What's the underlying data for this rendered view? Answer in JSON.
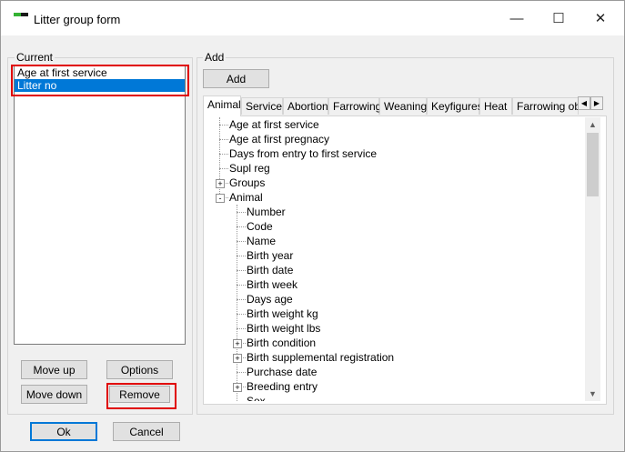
{
  "window": {
    "title": "Litter group form",
    "minimize_glyph": "—",
    "maximize_glyph": "☐",
    "close_glyph": "✕"
  },
  "current": {
    "label": "Current",
    "items": [
      {
        "label": "Age at first service",
        "selected": false
      },
      {
        "label": "Litter no",
        "selected": true
      }
    ],
    "move_up": "Move up",
    "move_down": "Move down",
    "options": "Options",
    "remove": "Remove"
  },
  "add": {
    "label": "Add",
    "add_button": "Add",
    "tabs": [
      "Animal",
      "Service",
      "Abortion",
      "Farrowing",
      "Weaning",
      "Keyfigures",
      "Heat",
      "Farrowing ob"
    ],
    "active_tab": "Animal",
    "tree": [
      {
        "label": "Age at first service",
        "level": 0,
        "expander": ""
      },
      {
        "label": "Age at first pregnacy",
        "level": 0,
        "expander": ""
      },
      {
        "label": "Days from entry to first service",
        "level": 0,
        "expander": ""
      },
      {
        "label": "Supl reg",
        "level": 0,
        "expander": ""
      },
      {
        "label": "Groups",
        "level": 0,
        "expander": "+"
      },
      {
        "label": "Animal",
        "level": 0,
        "expander": "-"
      },
      {
        "label": "Number",
        "level": 1,
        "expander": ""
      },
      {
        "label": "Code",
        "level": 1,
        "expander": ""
      },
      {
        "label": "Name",
        "level": 1,
        "expander": ""
      },
      {
        "label": "Birth year",
        "level": 1,
        "expander": ""
      },
      {
        "label": "Birth date",
        "level": 1,
        "expander": ""
      },
      {
        "label": "Birth week",
        "level": 1,
        "expander": ""
      },
      {
        "label": "Days age",
        "level": 1,
        "expander": ""
      },
      {
        "label": "Birth weight kg",
        "level": 1,
        "expander": ""
      },
      {
        "label": "Birth weight lbs",
        "level": 1,
        "expander": ""
      },
      {
        "label": "Birth condition",
        "level": 1,
        "expander": "+"
      },
      {
        "label": "Birth supplemental registration",
        "level": 1,
        "expander": "+"
      },
      {
        "label": "Purchase date",
        "level": 1,
        "expander": ""
      },
      {
        "label": "Breeding entry",
        "level": 1,
        "expander": "+"
      },
      {
        "label": "Sex",
        "level": 1,
        "expander": ""
      }
    ]
  },
  "footer": {
    "ok": "Ok",
    "cancel": "Cancel"
  },
  "colors": {
    "selection": "#0078d7",
    "highlight_box": "#e00000",
    "icon_green": "#35b233"
  }
}
